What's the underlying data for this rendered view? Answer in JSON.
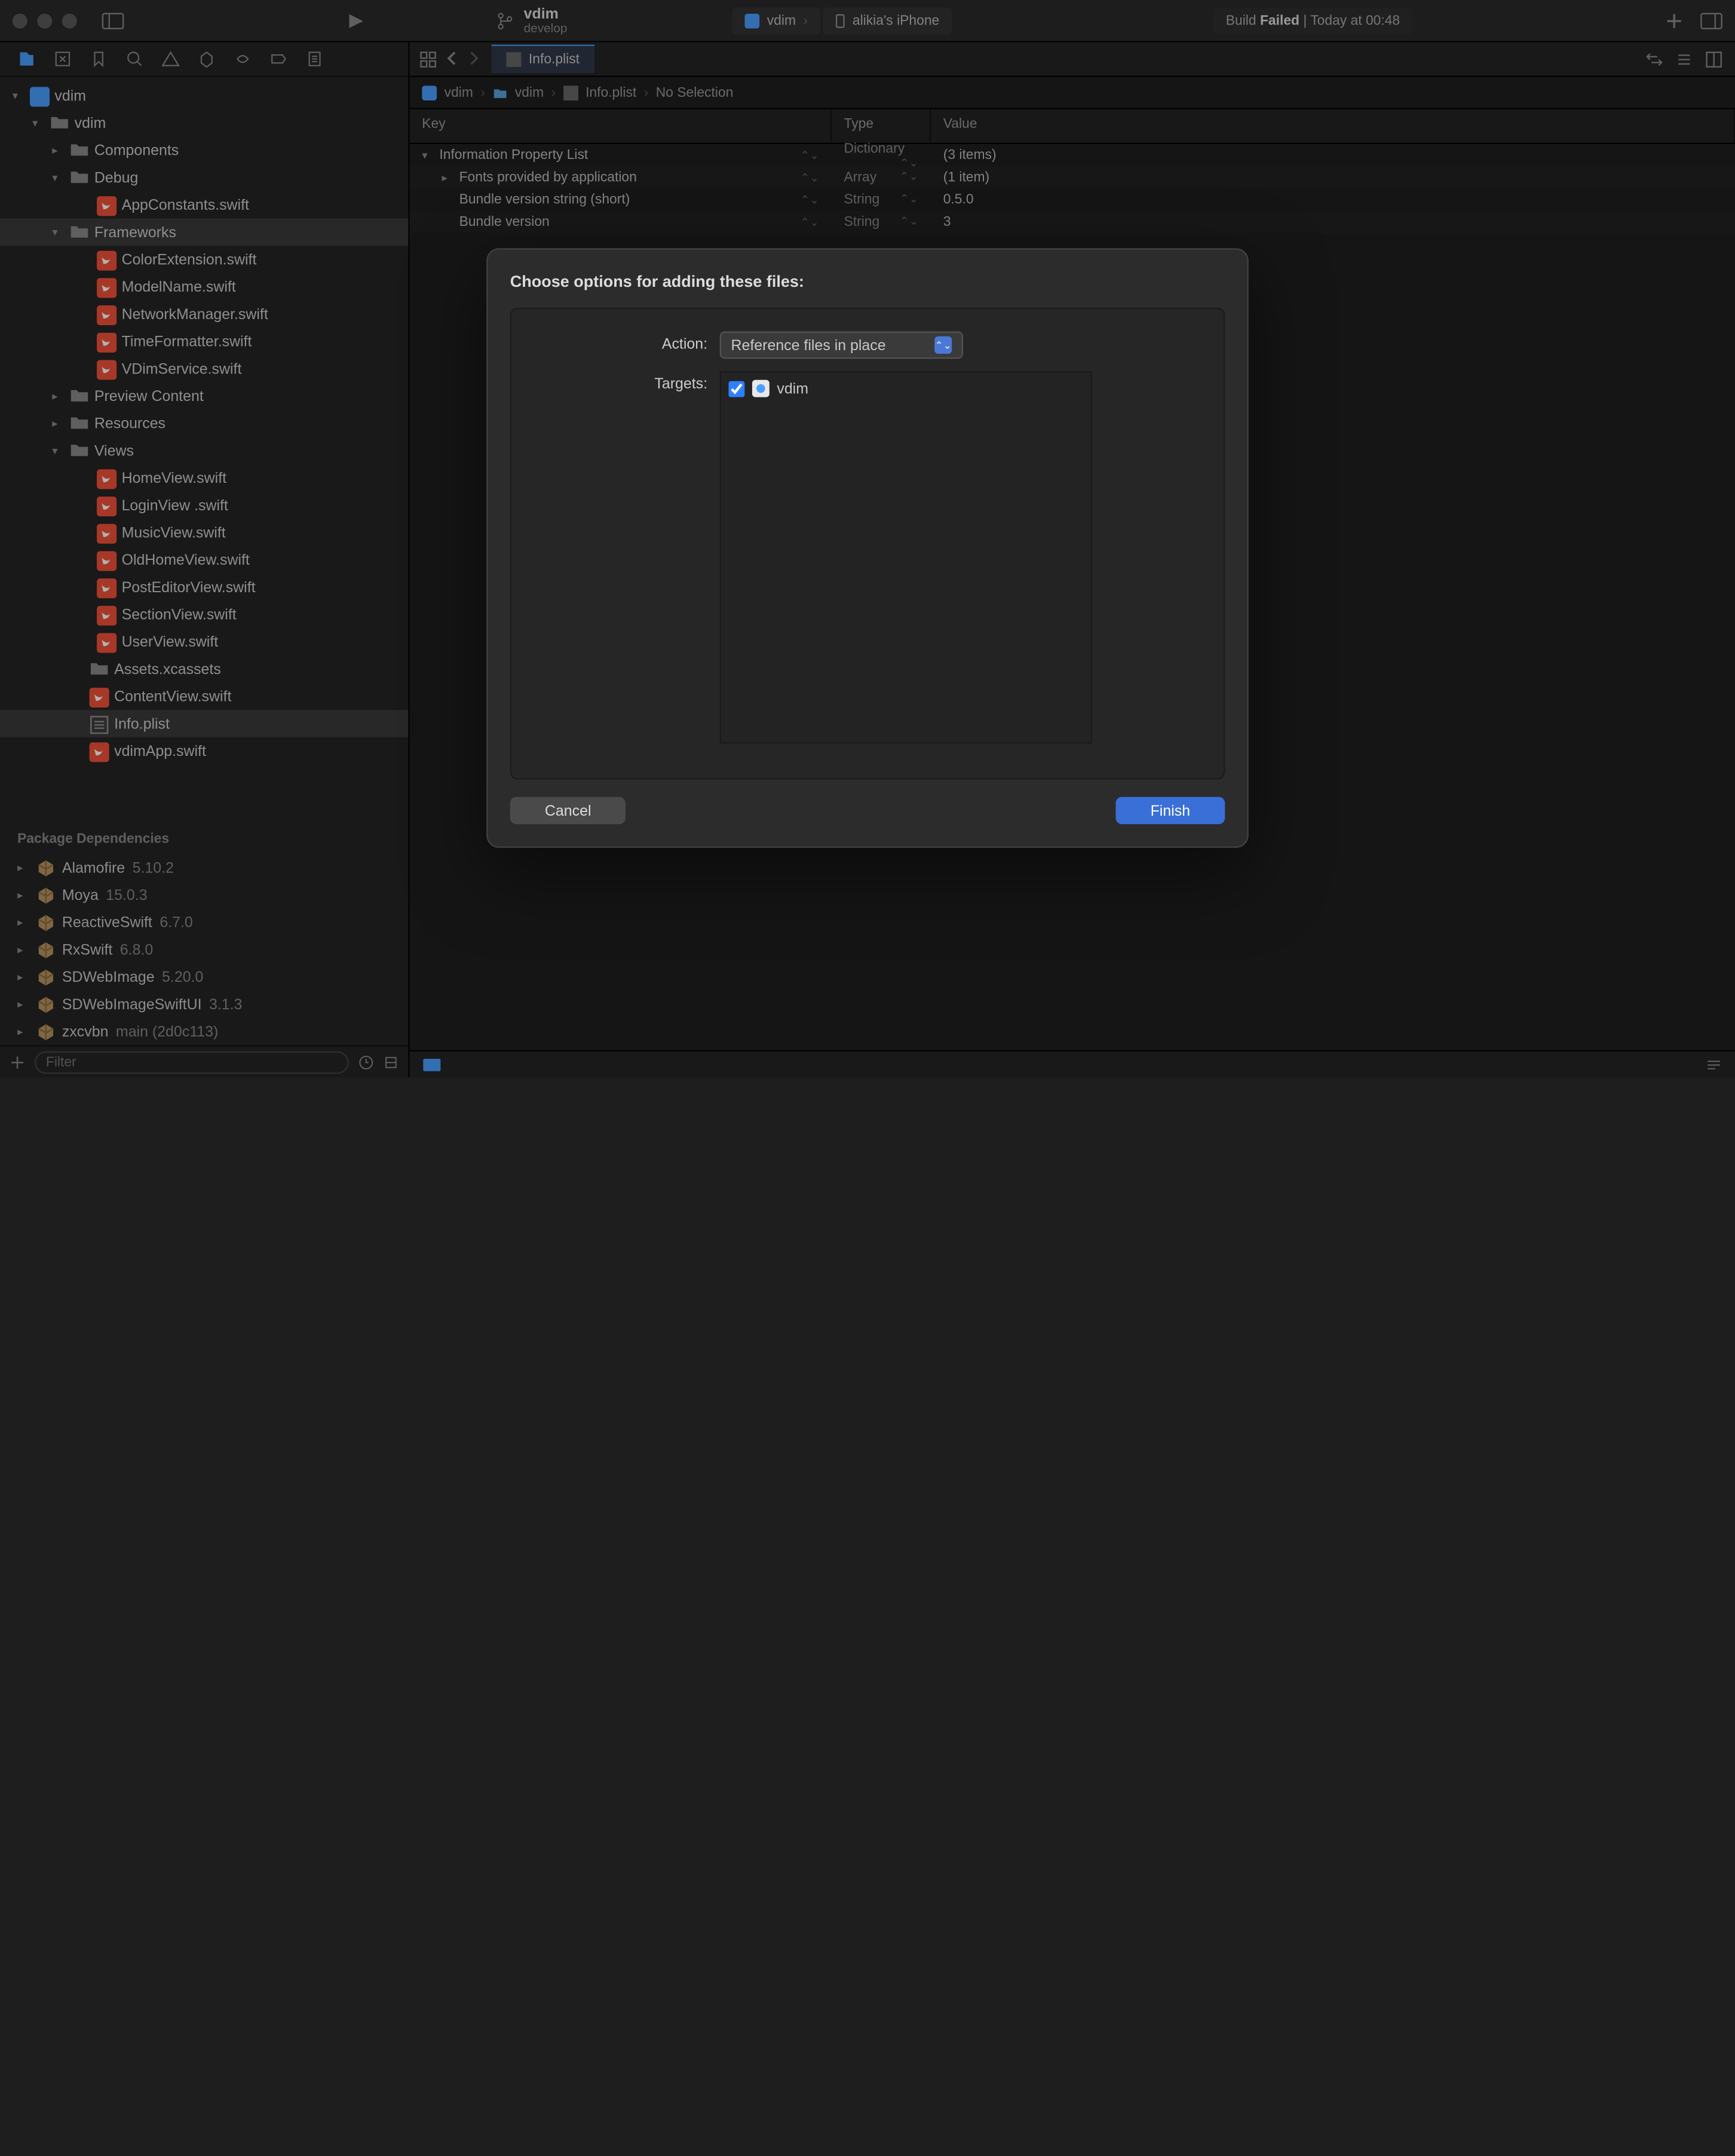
{
  "titlebar": {
    "project": "vdim",
    "branch": "develop",
    "scheme_tabs": [
      {
        "icon": "app",
        "label": "vdim"
      },
      {
        "icon": "device",
        "label": "alikia's iPhone"
      }
    ],
    "build_status_prefix": "Build ",
    "build_status_word": "Failed",
    "build_status_suffix": " | Today at 00:48"
  },
  "editor": {
    "tab_label": "Info.plist",
    "breadcrumb": [
      "vdim",
      "vdim",
      "Info.plist",
      "No Selection"
    ]
  },
  "plist": {
    "headers": {
      "key": "Key",
      "type": "Type",
      "value": "Value"
    },
    "rows": [
      {
        "key": "Information Property List",
        "type": "Dictionary",
        "value": "(3 items)",
        "indent": 0,
        "disc": "v"
      },
      {
        "key": "Fonts provided by application",
        "type": "Array",
        "value": "(1 item)",
        "indent": 1,
        "disc": ">"
      },
      {
        "key": "Bundle version string (short)",
        "type": "String",
        "value": "0.5.0",
        "indent": 1,
        "disc": ""
      },
      {
        "key": "Bundle version",
        "type": "String",
        "value": "3",
        "indent": 1,
        "disc": ""
      }
    ]
  },
  "tree": [
    {
      "label": "vdim",
      "icon": "app",
      "indent": 0,
      "disc": "v"
    },
    {
      "label": "vdim",
      "icon": "folder",
      "indent": 1,
      "disc": "v"
    },
    {
      "label": "Components",
      "icon": "folder",
      "indent": 2,
      "disc": ">"
    },
    {
      "label": "Debug",
      "icon": "folder",
      "indent": 2,
      "disc": "v"
    },
    {
      "label": "AppConstants.swift",
      "icon": "swift",
      "indent": 4
    },
    {
      "label": "Frameworks",
      "icon": "folder",
      "indent": 2,
      "disc": "v",
      "selected": true
    },
    {
      "label": "ColorExtension.swift",
      "icon": "swift",
      "indent": 4
    },
    {
      "label": "ModelName.swift",
      "icon": "swift",
      "indent": 4
    },
    {
      "label": "NetworkManager.swift",
      "icon": "swift",
      "indent": 4
    },
    {
      "label": "TimeFormatter.swift",
      "icon": "swift",
      "indent": 4
    },
    {
      "label": "VDimService.swift",
      "icon": "swift",
      "indent": 4
    },
    {
      "label": "Preview Content",
      "icon": "folder",
      "indent": 2,
      "disc": ">"
    },
    {
      "label": "Resources",
      "icon": "folder",
      "indent": 2,
      "disc": ">"
    },
    {
      "label": "Views",
      "icon": "folder",
      "indent": 2,
      "disc": "v"
    },
    {
      "label": "HomeView.swift",
      "icon": "swift",
      "indent": 4
    },
    {
      "label": "LoginView .swift",
      "icon": "swift",
      "indent": 4
    },
    {
      "label": "MusicView.swift",
      "icon": "swift",
      "indent": 4
    },
    {
      "label": "OldHomeView.swift",
      "icon": "swift",
      "indent": 4
    },
    {
      "label": "PostEditorView.swift",
      "icon": "swift",
      "indent": 4
    },
    {
      "label": "SectionView.swift",
      "icon": "swift",
      "indent": 4
    },
    {
      "label": "UserView.swift",
      "icon": "swift",
      "indent": 4
    },
    {
      "label": "Assets.xcassets",
      "icon": "folder",
      "indent": 3
    },
    {
      "label": "ContentView.swift",
      "icon": "swift",
      "indent": 3
    },
    {
      "label": "Info.plist",
      "icon": "plist",
      "indent": 3,
      "selected": true
    },
    {
      "label": "vdimApp.swift",
      "icon": "swift",
      "indent": 3
    }
  ],
  "packages_header": "Package Dependencies",
  "packages": [
    {
      "name": "Alamofire",
      "ver": "5.10.2"
    },
    {
      "name": "Moya",
      "ver": "15.0.3"
    },
    {
      "name": "ReactiveSwift",
      "ver": "6.7.0"
    },
    {
      "name": "RxSwift",
      "ver": "6.8.0"
    },
    {
      "name": "SDWebImage",
      "ver": "5.20.0"
    },
    {
      "name": "SDWebImageSwiftUI",
      "ver": "3.1.3"
    },
    {
      "name": "zxcvbn",
      "ver": "main (2d0c113)"
    }
  ],
  "filter_placeholder": "Filter",
  "modal": {
    "title": "Choose options for adding these files:",
    "action_label": "Action:",
    "action_value": "Reference files in place",
    "targets_label": "Targets:",
    "target_name": "vdim",
    "cancel": "Cancel",
    "finish": "Finish"
  }
}
